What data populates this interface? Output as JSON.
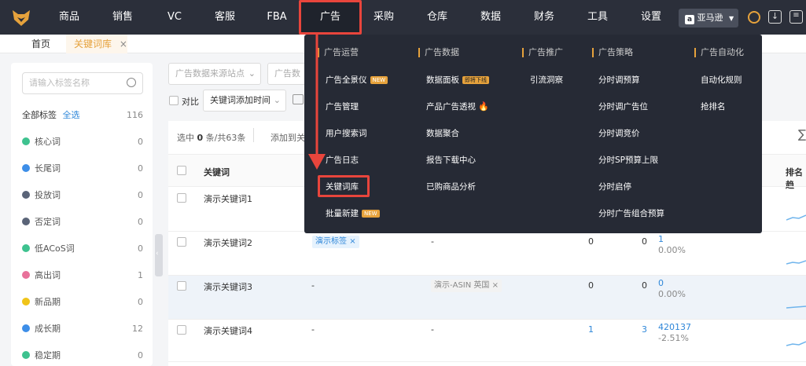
{
  "nav": {
    "items": [
      {
        "label": "商品"
      },
      {
        "label": "销售"
      },
      {
        "label": "VC"
      },
      {
        "label": "客服"
      },
      {
        "label": "FBA"
      },
      {
        "label": "广告"
      },
      {
        "label": "采购"
      },
      {
        "label": "仓库"
      },
      {
        "label": "数据"
      },
      {
        "label": "财务"
      },
      {
        "label": "工具"
      },
      {
        "label": "设置"
      }
    ],
    "marketplace": "亚马逊",
    "colors": {
      "bg": "#2b2f3a",
      "highlight": "#e8453c",
      "accent": "#e6a23c"
    }
  },
  "tabs": {
    "home": "首页",
    "active": "关键词库",
    "close": "×"
  },
  "left": {
    "search_placeholder": "请输入标签名称",
    "all_tags": "全部标签",
    "select_all": "全选",
    "all_count": "116",
    "tags": [
      {
        "name": "核心词",
        "count": "0",
        "color": "#3ec28f"
      },
      {
        "name": "长尾词",
        "count": "0",
        "color": "#3d8ee8"
      },
      {
        "name": "投放词",
        "count": "0",
        "color": "#5a6478"
      },
      {
        "name": "否定词",
        "count": "0",
        "color": "#5a6478"
      },
      {
        "name": "低ACoS词",
        "count": "0",
        "color": "#3ec28f"
      },
      {
        "name": "高出词",
        "count": "1",
        "color": "#e8719a"
      },
      {
        "name": "新品期",
        "count": "0",
        "color": "#f0c419"
      },
      {
        "name": "成长期",
        "count": "12",
        "color": "#3d8ee8"
      },
      {
        "name": "稳定期",
        "count": "0",
        "color": "#3ec28f"
      }
    ]
  },
  "filters": {
    "site": "广告数据来源站点",
    "data": "广告数据",
    "compare": "对比",
    "time": "关键词添加时间"
  },
  "table": {
    "selected_prefix": "选中",
    "selected_count": "0",
    "selected_suffix": "条/共63条",
    "add_to": "添加到关",
    "col_keyword": "关键词",
    "col_rank": "排名趋",
    "rows": [
      {
        "keyword": "演示关键词1"
      },
      {
        "keyword": "演示关键词2",
        "tag": "演示标签",
        "c3": "-",
        "c4": "0",
        "c5": "0",
        "c6": "1",
        "c7": "0.00%"
      },
      {
        "keyword": "演示关键词3",
        "c2": "-",
        "asin": "演示-ASIN 英国",
        "c4": "0",
        "c5": "0",
        "c6": "0",
        "c7": "0.00%"
      },
      {
        "keyword": "演示关键词4",
        "c2": "-",
        "c3": "-",
        "c4": "1",
        "c5": "3",
        "c6": "420137",
        "c7": "-2.51%"
      }
    ]
  },
  "dropdown": {
    "columns": [
      {
        "header": "广告运营",
        "items": [
          {
            "label": "广告全景仪",
            "badge": "NEW"
          },
          {
            "label": "广告管理"
          },
          {
            "label": "用户搜索词"
          },
          {
            "label": "广告日志"
          },
          {
            "label": "关键词库"
          },
          {
            "label": "批量新建",
            "badge": "NEW"
          }
        ]
      },
      {
        "header": "广告数据",
        "items": [
          {
            "label": "数据面板",
            "badge": "即将下线"
          },
          {
            "label": "产品广告透视",
            "icon": "🔥"
          },
          {
            "label": "数据聚合"
          },
          {
            "label": "报告下载中心"
          },
          {
            "label": "已购商品分析"
          }
        ]
      },
      {
        "header": "广告推广",
        "items": [
          {
            "label": "引流洞察"
          }
        ]
      },
      {
        "header": "广告策略",
        "items": [
          {
            "label": "分时调预算"
          },
          {
            "label": "分时调广告位"
          },
          {
            "label": "分时调竞价"
          },
          {
            "label": "分时SP预算上限"
          },
          {
            "label": "分时启停"
          },
          {
            "label": "分时广告组合预算"
          }
        ]
      },
      {
        "header": "广告自动化",
        "items": [
          {
            "label": "自动化规则"
          },
          {
            "label": "抢排名"
          }
        ]
      }
    ]
  }
}
